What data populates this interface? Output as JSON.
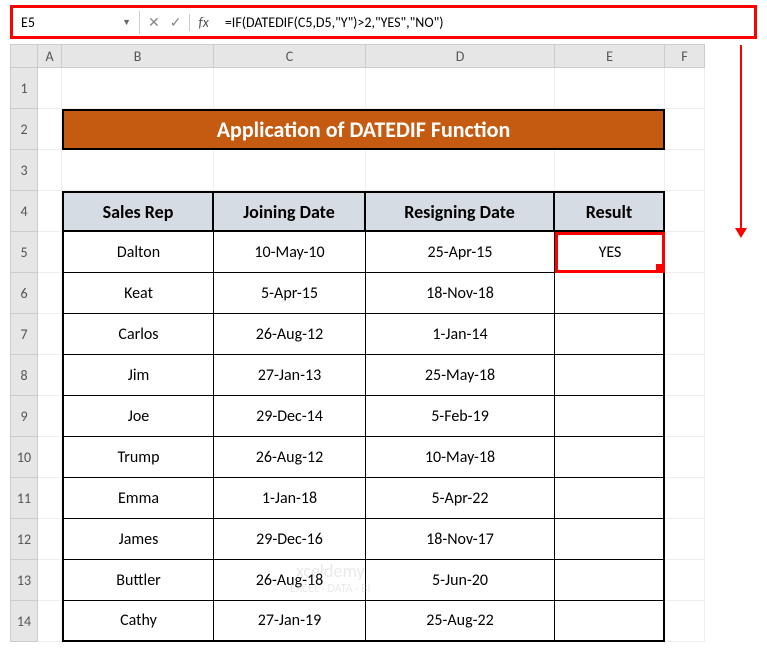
{
  "nameBox": {
    "value": "E5"
  },
  "formulaBar": {
    "formula": "=IF(DATEDIF(C5,D5,\"Y\")>2,\"YES\",\"NO\")"
  },
  "columns": [
    "A",
    "B",
    "C",
    "D",
    "E",
    "F"
  ],
  "rows": [
    "1",
    "2",
    "3",
    "4",
    "5",
    "6",
    "7",
    "8",
    "9",
    "10",
    "11",
    "12",
    "13",
    "14"
  ],
  "title": "Application of DATEDIF Function",
  "headers": {
    "salesRep": "Sales Rep",
    "joiningDate": "Joining Date",
    "resigningDate": "Resigning Date",
    "result": "Result"
  },
  "chart_data": {
    "type": "table",
    "title": "Application of DATEDIF Function",
    "columns": [
      "Sales Rep",
      "Joining Date",
      "Resigning Date",
      "Result"
    ],
    "rows": [
      {
        "salesRep": "Dalton",
        "joiningDate": "10-May-10",
        "resigningDate": "25-Apr-15",
        "result": "YES"
      },
      {
        "salesRep": "Keat",
        "joiningDate": "5-Apr-15",
        "resigningDate": "18-Nov-18",
        "result": ""
      },
      {
        "salesRep": "Carlos",
        "joiningDate": "26-Aug-12",
        "resigningDate": "1-Jan-14",
        "result": ""
      },
      {
        "salesRep": "Jim",
        "joiningDate": "27-Jan-13",
        "resigningDate": "25-May-18",
        "result": ""
      },
      {
        "salesRep": "Joe",
        "joiningDate": "29-Dec-14",
        "resigningDate": "5-Feb-19",
        "result": ""
      },
      {
        "salesRep": "Trump",
        "joiningDate": "26-Aug-12",
        "resigningDate": "10-May-18",
        "result": ""
      },
      {
        "salesRep": "Emma",
        "joiningDate": "1-Jan-18",
        "resigningDate": "5-Apr-22",
        "result": ""
      },
      {
        "salesRep": "James",
        "joiningDate": "29-Dec-16",
        "resigningDate": "18-Nov-17",
        "result": ""
      },
      {
        "salesRep": "Buttler",
        "joiningDate": "26-Aug-18",
        "resigningDate": "5-Jun-20",
        "result": ""
      },
      {
        "salesRep": "Cathy",
        "joiningDate": "27-Jan-19",
        "resigningDate": "25-Aug-22",
        "result": ""
      }
    ]
  },
  "watermark": {
    "brand": "xceldemy",
    "tagline": "EXCEL · DATA · BI"
  }
}
